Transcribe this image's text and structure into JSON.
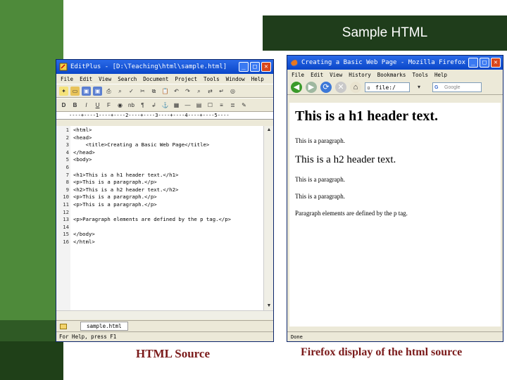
{
  "slide": {
    "title": "Sample HTML",
    "caption_left": "HTML Source",
    "caption_right": "Firefox display of the html source"
  },
  "editor": {
    "title": "EditPlus - [D:\\Teaching\\html\\sample.html]",
    "menu": [
      "File",
      "Edit",
      "View",
      "Search",
      "Document",
      "Project",
      "Tools",
      "Window",
      "Help"
    ],
    "ruler": "----+----1----+----2----+----3----+----4----+----5----",
    "lines": [
      {
        "n": "1",
        "code": "<html>"
      },
      {
        "n": "2",
        "code": "<head>"
      },
      {
        "n": "3",
        "code": "    <title>Creating a Basic Web Page</title>"
      },
      {
        "n": "4",
        "code": "</head>"
      },
      {
        "n": "5",
        "code": "<body>"
      },
      {
        "n": "6",
        "code": ""
      },
      {
        "n": "7",
        "code": "<h1>This is a h1 header text.</h1>"
      },
      {
        "n": "8",
        "code": "<p>This is a paragraph.</p>"
      },
      {
        "n": "9",
        "code": "<h2>This is a h2 header text.</h2>"
      },
      {
        "n": "10",
        "code": "<p>This is a paragraph.</p>"
      },
      {
        "n": "11",
        "code": "<p>This is a paragraph.</p>"
      },
      {
        "n": "12",
        "code": ""
      },
      {
        "n": "13",
        "code": "<p>Paragraph elements are defined by the p tag.</p>"
      },
      {
        "n": "14",
        "code": ""
      },
      {
        "n": "15",
        "code": "</body>"
      },
      {
        "n": "16",
        "code": "</html>"
      }
    ],
    "tab_label": "sample.html",
    "status": "For Help, press F1"
  },
  "firefox": {
    "title": "Creating a Basic Web Page - Mozilla Firefox",
    "menu": [
      "File",
      "Edit",
      "View",
      "History",
      "Bookmarks",
      "Tools",
      "Help"
    ],
    "url": "file:/",
    "search_placeholder": "Google",
    "content": {
      "h1": "This is a h1 header text.",
      "p1": "This is a paragraph.",
      "h2": "This is a h2 header text.",
      "p2": "This is a paragraph.",
      "p3": "This is a paragraph.",
      "p4": "Paragraph elements are defined by the p tag."
    },
    "status": "Done"
  }
}
